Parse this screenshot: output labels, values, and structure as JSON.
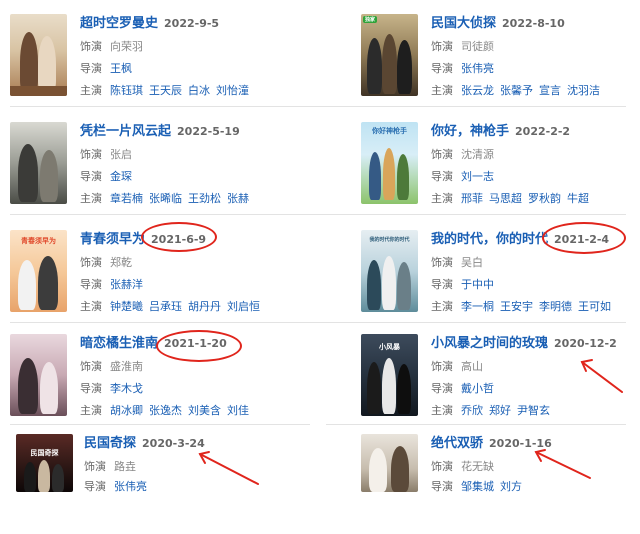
{
  "labels": {
    "role": "饰演",
    "director": "导演",
    "cast": "主演"
  },
  "colors": {
    "link": "#1a5fb4",
    "annotation": "#e0251c"
  },
  "cards": [
    {
      "title": "超时空罗曼史",
      "date": "2022-9-5",
      "role": "向荣羽",
      "director": "王枫",
      "cast": [
        "陈钰琪",
        "王天辰",
        "白冰",
        "刘怡潼"
      ]
    },
    {
      "title": "民国大侦探",
      "date": "2022-8-10",
      "role": "司徒颜",
      "director": "张伟亮",
      "cast": [
        "张云龙",
        "张馨予",
        "宣言",
        "沈羽洁"
      ],
      "badge": "独家"
    },
    {
      "title": "凭栏一片风云起",
      "date": "2022-5-19",
      "role": "张启",
      "director": "金琛",
      "cast": [
        "章若楠",
        "张晞临",
        "王劲松",
        "张赫"
      ]
    },
    {
      "title": "你好，神枪手",
      "date": "2022-2-2",
      "role": "沈清源",
      "director": "刘一志",
      "cast": [
        "邢菲",
        "马思超",
        "罗秋韵",
        "牛超"
      ],
      "poster_text": "你好神枪手"
    },
    {
      "title": "青春须早为",
      "date": "2021-6-9",
      "role": "郑乾",
      "director": "张赫洋",
      "cast": [
        "钟楚曦",
        "吕承珏",
        "胡丹丹",
        "刘启恒"
      ],
      "poster_text": "青春须早为"
    },
    {
      "title": "我的时代，你的时代",
      "date": "2021-2-4",
      "role": "吴白",
      "director": "于中中",
      "cast": [
        "李一桐",
        "王安宇",
        "李明德",
        "王可如"
      ],
      "poster_text": "我的时代你的时代"
    },
    {
      "title": "暗恋橘生淮南",
      "date": "2021-1-20",
      "role": "盛淮南",
      "director": "李木戈",
      "cast": [
        "胡冰卿",
        "张逸杰",
        "刘美含",
        "刘佳"
      ]
    },
    {
      "title": "小风暴之时间的玫瑰",
      "date": "2020-12-2",
      "role": "高山",
      "director": "戴小哲",
      "cast": [
        "乔欣",
        "郑好",
        "尹智玄"
      ],
      "poster_text": "小风暴"
    },
    {
      "title": "民国奇探",
      "date": "2020-3-24",
      "role": "路垚",
      "director": "张伟亮",
      "cast": [],
      "poster_text": "民国奇探"
    },
    {
      "title": "绝代双骄",
      "date": "2020-1-16",
      "role": "花无缺",
      "director": "邹集城",
      "cast": [],
      "director_extra": "刘方"
    }
  ]
}
